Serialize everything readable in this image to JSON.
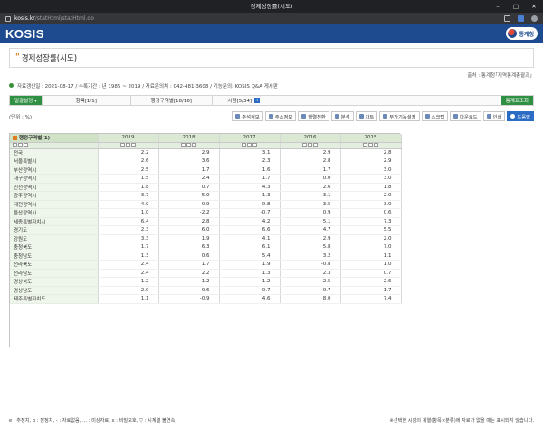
{
  "browser": {
    "window_title": "경제성장률(시도)",
    "url_host": "kosis.kr",
    "url_path": "/statHtml/statHtml.do"
  },
  "header": {
    "logo": "KOSIS",
    "agency": "통계청"
  },
  "page": {
    "title": "경제성장률(시도)",
    "source": "출처 : 통계청｢지역통계총괄과｣",
    "info": "자료갱신일 : 2021-08-17 / 수록기간 : 년 1985 ~ 2019 / 자료문의처 : 042-481-3608 / 기능문의: KOSIS Q&A 게시판"
  },
  "tabs": {
    "settings": "일괄설정 ▾",
    "item": "항목[1/1]",
    "region": "행정구역별[18/18]",
    "time": "시점[5/34]",
    "time_plus": "+",
    "report": "통계표조회"
  },
  "toolbar": {
    "unit": "(단위 : %)",
    "buttons": [
      "주석정보",
      "주소정보",
      "행렬전환",
      "분석",
      "차트",
      "부가기능설정",
      "스크랩",
      "다운로드",
      "인쇄",
      "도움말"
    ]
  },
  "table": {
    "region_header": "행정구역별(1)",
    "years": [
      "2019",
      "2018",
      "2017",
      "2016",
      "2015"
    ],
    "rows": [
      {
        "region": "전국",
        "values": [
          "2.2",
          "2.9",
          "3.1",
          "2.9",
          "2.8"
        ]
      },
      {
        "region": "서울특별시",
        "values": [
          "2.6",
          "3.6",
          "2.3",
          "2.8",
          "2.9"
        ]
      },
      {
        "region": "부산광역시",
        "values": [
          "2.5",
          "1.7",
          "1.6",
          "1.7",
          "3.0"
        ]
      },
      {
        "region": "대구광역시",
        "values": [
          "1.5",
          "2.4",
          "1.7",
          "0.0",
          "3.0"
        ]
      },
      {
        "region": "인천광역시",
        "values": [
          "1.8",
          "0.7",
          "4.3",
          "2.6",
          "1.8"
        ]
      },
      {
        "region": "광주광역시",
        "values": [
          "3.7",
          "5.0",
          "1.3",
          "3.1",
          "2.0"
        ]
      },
      {
        "region": "대전광역시",
        "values": [
          "4.0",
          "0.9",
          "0.8",
          "3.5",
          "3.0"
        ]
      },
      {
        "region": "울산광역시",
        "values": [
          "1.0",
          "-2.2",
          "-0.7",
          "0.9",
          "0.6"
        ]
      },
      {
        "region": "세종특별자치시",
        "values": [
          "6.4",
          "2.8",
          "4.2",
          "5.1",
          "7.3"
        ]
      },
      {
        "region": "경기도",
        "values": [
          "2.3",
          "6.0",
          "6.6",
          "4.7",
          "5.5"
        ]
      },
      {
        "region": "강원도",
        "values": [
          "3.3",
          "1.9",
          "4.1",
          "2.9",
          "2.0"
        ]
      },
      {
        "region": "충청북도",
        "values": [
          "1.7",
          "6.3",
          "6.1",
          "5.8",
          "7.0"
        ]
      },
      {
        "region": "충청남도",
        "values": [
          "1.3",
          "0.6",
          "5.4",
          "3.2",
          "1.1"
        ]
      },
      {
        "region": "전라북도",
        "values": [
          "2.4",
          "1.7",
          "1.9",
          "-0.8",
          "1.0"
        ]
      },
      {
        "region": "전라남도",
        "values": [
          "2.4",
          "2.2",
          "1.3",
          "2.3",
          "0.7"
        ]
      },
      {
        "region": "경상북도",
        "values": [
          "1.2",
          "-1.2",
          "-1.2",
          "2.5",
          "-2.6"
        ]
      },
      {
        "region": "경상남도",
        "values": [
          "2.0",
          "0.6",
          "-0.7",
          "0.7",
          "1.7"
        ]
      },
      {
        "region": "제주특별자치도",
        "values": [
          "1.1",
          "-0.9",
          "4.6",
          "8.0",
          "7.4"
        ]
      }
    ]
  },
  "footer": {
    "legend": "e : 추정치, p : 잠정치, - : 자료없음, ... : 미상자료, x : 비밀보호, ▽ : 시계열 불연속",
    "note": "※선택한 시점의 계열(항목×분류)에 자료가 없을 때는 표시되지 않습니다."
  },
  "colors": {
    "header_blue": "#1e4a8f",
    "accent_green": "#2f8f43",
    "grid_header": "#dbe9d4",
    "title_accent": "#e07b21"
  }
}
